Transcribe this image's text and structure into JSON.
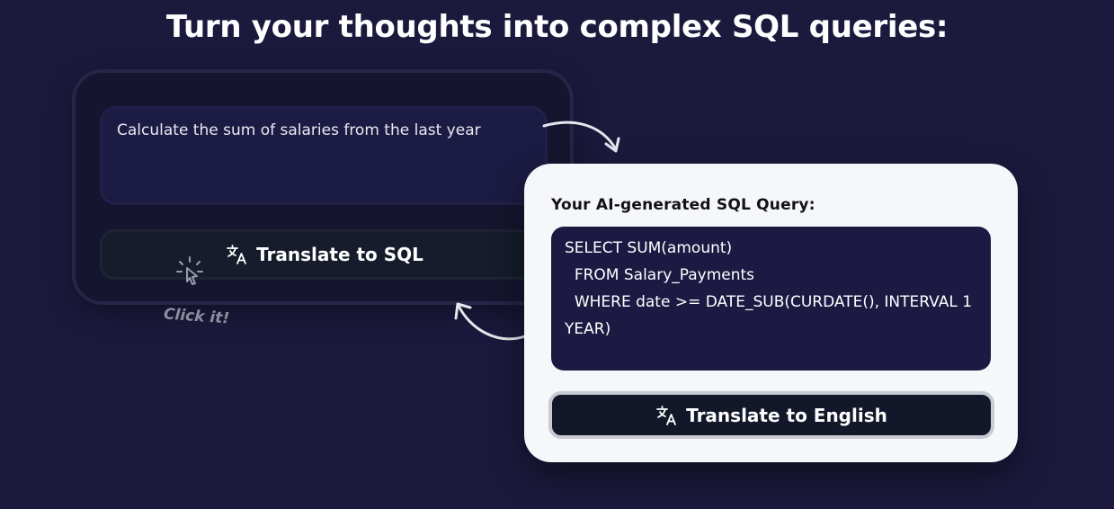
{
  "headline": "Turn your thoughts into complex SQL queries:",
  "prompt": {
    "text": "Calculate the sum of salaries from the last year"
  },
  "translate_sql_button": {
    "label": "Translate to SQL",
    "icon": "translate-icon"
  },
  "hint": {
    "label": "Click it!",
    "icon": "click-cursor-icon"
  },
  "result": {
    "title": "Your AI-generated SQL Query:",
    "sql_lines": [
      "SELECT SUM(amount)",
      "  FROM Salary_Payments",
      "  WHERE date >= DATE_SUB(CURDATE(), INTERVAL 1 YEAR)"
    ]
  },
  "translate_english_button": {
    "label": "Translate to English",
    "icon": "translate-icon"
  },
  "colors": {
    "background": "#1b1a3d",
    "panel": "#16152f",
    "input_bg": "#1c1b43",
    "card_bg": "#f6f7fa",
    "button_dark": "#121829"
  }
}
